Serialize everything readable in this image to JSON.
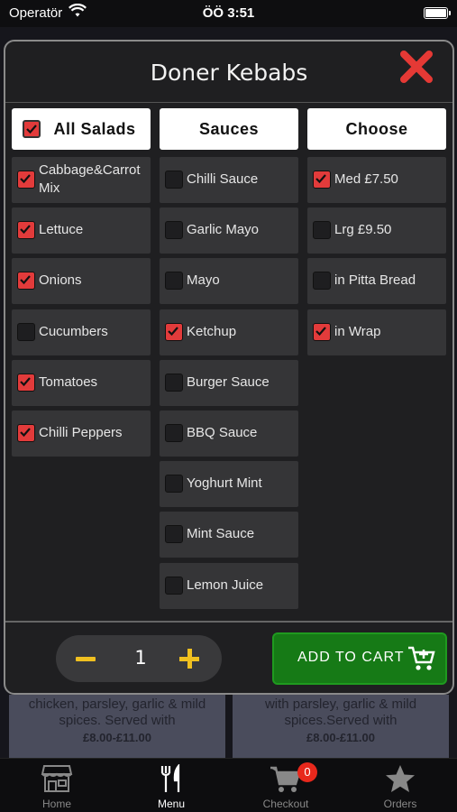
{
  "status_bar": {
    "carrier": "Operatör",
    "time": "ÖÖ 3:51"
  },
  "background_cards": [
    {
      "description": "chicken, parsley, garlic & mild spices. Served with",
      "price": "£8.00-£11.00"
    },
    {
      "description": "with parsley, garlic & mild spices.Served with",
      "price": "£8.00-£11.00"
    }
  ],
  "modal": {
    "title": "Doner Kebabs",
    "columns": {
      "salads": {
        "header": "All Salads",
        "header_checked": true,
        "items": [
          {
            "label": "Cabbage&Carrot Mix",
            "checked": true
          },
          {
            "label": "Lettuce",
            "checked": true
          },
          {
            "label": "Onions",
            "checked": true
          },
          {
            "label": "Cucumbers",
            "checked": false
          },
          {
            "label": "Tomatoes",
            "checked": true
          },
          {
            "label": "Chilli Peppers",
            "checked": true
          }
        ]
      },
      "sauces": {
        "header": "Sauces",
        "items": [
          {
            "label": "Chilli Sauce",
            "checked": false
          },
          {
            "label": "Garlic Mayo",
            "checked": false
          },
          {
            "label": "Mayo",
            "checked": false
          },
          {
            "label": "Ketchup",
            "checked": true
          },
          {
            "label": "Burger Sauce",
            "checked": false
          },
          {
            "label": "BBQ Sauce",
            "checked": false
          },
          {
            "label": "Yoghurt Mint",
            "checked": false
          },
          {
            "label": "Mint Sauce",
            "checked": false
          },
          {
            "label": "Lemon Juice",
            "checked": false
          }
        ]
      },
      "choose": {
        "header": "Choose",
        "items": [
          {
            "label": "Med £7.50",
            "checked": true
          },
          {
            "label": "Lrg £9.50",
            "checked": false
          },
          {
            "label": "in Pitta Bread",
            "checked": false
          },
          {
            "label": "in Wrap",
            "checked": true
          }
        ]
      }
    },
    "footer": {
      "quantity": "1",
      "add_to_cart_label": "ADD TO CART"
    }
  },
  "tabbar": {
    "tabs": [
      {
        "label": "Home",
        "icon": "store-icon",
        "active": false
      },
      {
        "label": "Menu",
        "icon": "fork-knife-icon",
        "active": true
      },
      {
        "label": "Checkout",
        "icon": "cart-icon",
        "active": false
      },
      {
        "label": "Orders",
        "icon": "star-icon",
        "active": false
      }
    ],
    "checkout_badge": "0"
  },
  "colors": {
    "checked": "#e23b3b",
    "cart_button": "#167a16",
    "stepper_accent": "#f0c020",
    "close": "#e53935",
    "badge": "#e8281c"
  }
}
